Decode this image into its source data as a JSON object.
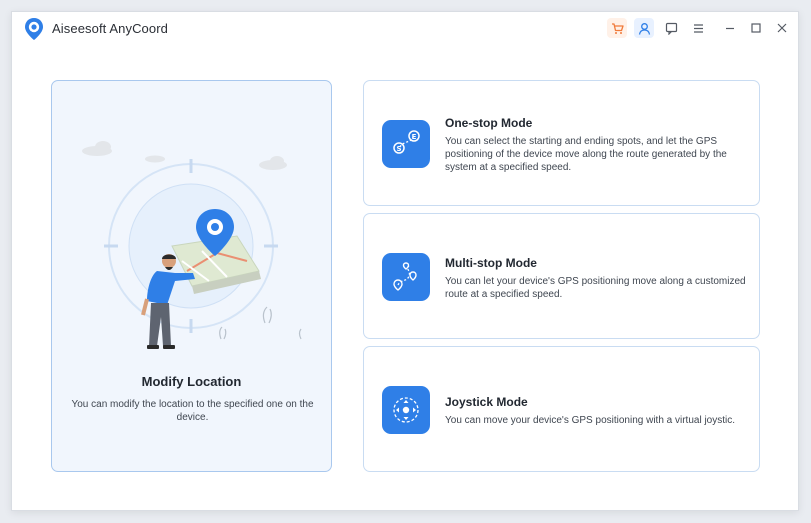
{
  "app": {
    "title": "Aiseesoft AnyCoord"
  },
  "main_card": {
    "title": "Modify Location",
    "description": "You can modify the location to the specified one on the device."
  },
  "modes": [
    {
      "title": "One-stop Mode",
      "description": "You can select the starting and ending spots, and let the GPS positioning of the device move along the route generated by the system at a specified speed.",
      "icon": "one-stop-route-icon"
    },
    {
      "title": "Multi-stop Mode",
      "description": "You can let your device's GPS positioning move along a customized route at a specified speed.",
      "icon": "multi-stop-route-icon"
    },
    {
      "title": "Joystick Mode",
      "description": "You can move your device's GPS positioning with a virtual joystic.",
      "icon": "joystick-icon"
    }
  ],
  "colors": {
    "accent": "#2f7fe7",
    "card_border": "#c9dcf2",
    "main_card_bg": "#f1f6fd",
    "cart": "#f07a3a"
  },
  "titlebar_icons": [
    "cart-icon",
    "user-icon",
    "feedback-icon",
    "menu-icon",
    "minimize-icon",
    "maximize-icon",
    "close-icon"
  ]
}
